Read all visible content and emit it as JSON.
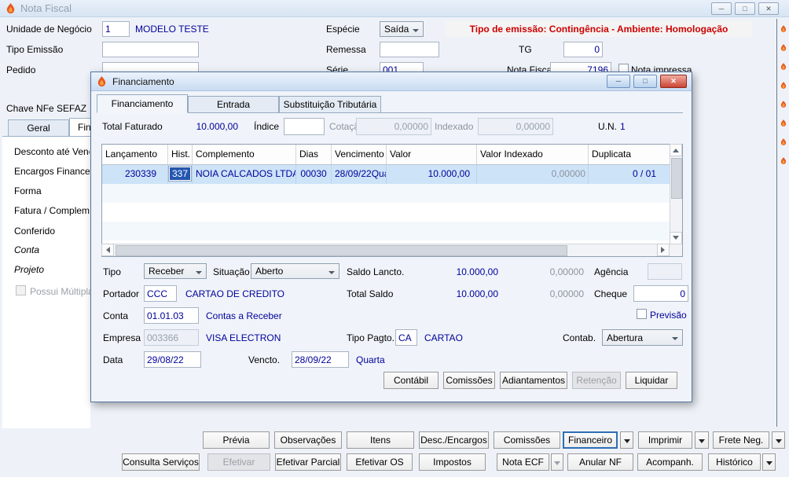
{
  "window": {
    "title": "Nota Fiscal"
  },
  "main": {
    "unidade_label": "Unidade de Negócio",
    "unidade_value": "1",
    "unidade_desc": "MODELO TESTE",
    "tipo_emissao_label": "Tipo Emissão",
    "pedido_label": "Pedido",
    "especie_label": "Espécie",
    "especie_value": "Saída",
    "remessa_label": "Remessa",
    "serie_label": "Série",
    "serie_value": "001",
    "tg_label": "TG",
    "tg_value": "0",
    "nota_fiscal_label": "Nota Fiscal",
    "nota_fiscal_value": "7196",
    "nota_impressa_label": "Nota impressa",
    "warning": "Tipo de emissão: Contingência - Ambiente: Homologação",
    "chave_label": "Chave NFe SEFAZ",
    "tabs": {
      "geral": "Geral",
      "fin": "Fin"
    },
    "sidebar_items": [
      "Desconto até Venc",
      "Encargos Financei",
      "Forma",
      "Fatura / Complem",
      "Conferido",
      "Conta",
      "Projeto"
    ],
    "possui_multipla_label": "Possui Múltipla"
  },
  "dialog": {
    "title": "Financiamento",
    "tabs": [
      "Financiamento",
      "Entrada",
      "Substituição Tributária"
    ],
    "summary": {
      "total_faturado_label": "Total Faturado",
      "total_faturado_value": "10.000,00",
      "indice_label": "Índice",
      "cotacao_label": "Cotação",
      "cotacao_value": "0,00000",
      "indexado_label": "Indexado",
      "indexado_value": "0,00000",
      "un_label": "U.N.",
      "un_value": "1"
    },
    "table": {
      "columns": [
        "Lançamento",
        "Hist.",
        "Complemento",
        "Dias",
        "Vencimento Orig.",
        "Valor",
        "Valor Indexado",
        "Duplicata"
      ],
      "row": {
        "lancamento": "230339",
        "hist": "337",
        "complemento": "NOIA CALCADOS LTDA",
        "dias": "00030",
        "vencimento": "28/09/22",
        "dia_semana": "Qua",
        "valor": "10.000,00",
        "valor_indexado": "0,00000",
        "duplicata": "0 / 01"
      }
    },
    "form": {
      "tipo_label": "Tipo",
      "tipo_value": "Receber",
      "situacao_label": "Situação",
      "situacao_value": "Aberto",
      "saldo_lancto_label": "Saldo Lancto.",
      "saldo_lancto_value": "10.000,00",
      "saldo_lancto_indexado": "0,00000",
      "agencia_label": "Agência",
      "portador_label": "Portador",
      "portador_value": "CCC",
      "portador_desc": "CARTAO DE CREDITO",
      "total_saldo_label": "Total Saldo",
      "total_saldo_value": "10.000,00",
      "total_saldo_indexado": "0,00000",
      "cheque_label": "Cheque",
      "cheque_value": "0",
      "previsao_label": "Previsão",
      "conta_label": "Conta",
      "conta_value": "01.01.03",
      "conta_desc": "Contas a Receber",
      "empresa_label": "Empresa",
      "empresa_value": "003366",
      "empresa_desc": "VISA ELECTRON",
      "tipo_pagto_label": "Tipo Pagto.",
      "tipo_pagto_value": "CA",
      "tipo_pagto_desc": "CARTAO",
      "contab_label": "Contab.",
      "contab_value": "Abertura",
      "data_label": "Data",
      "data_value": "29/08/22",
      "vencto_label": "Vencto.",
      "vencto_value": "28/09/22",
      "vencto_dia": "Quarta"
    },
    "buttons": [
      "Contábil",
      "Comissões",
      "Adiantamentos",
      "Retenção",
      "Liquidar"
    ]
  },
  "footer": {
    "row1": [
      "Prévia",
      "Observações",
      "Itens",
      "Desc./Encargos",
      "Comissões",
      "Financeiro",
      "Imprimir",
      "Frete Neg."
    ],
    "row2": [
      "Consulta Serviços",
      "Efetivar",
      "Efetivar Parcial",
      "Efetivar OS",
      "Impostos",
      "Nota ECF",
      "Anular NF",
      "Acompanh.",
      "Histórico"
    ]
  },
  "colors": {
    "accent_navy": "#000099",
    "warning_red": "#cc0000",
    "selection_blue": "#cde3f8",
    "hist_selected_bg": "#2456b0"
  }
}
